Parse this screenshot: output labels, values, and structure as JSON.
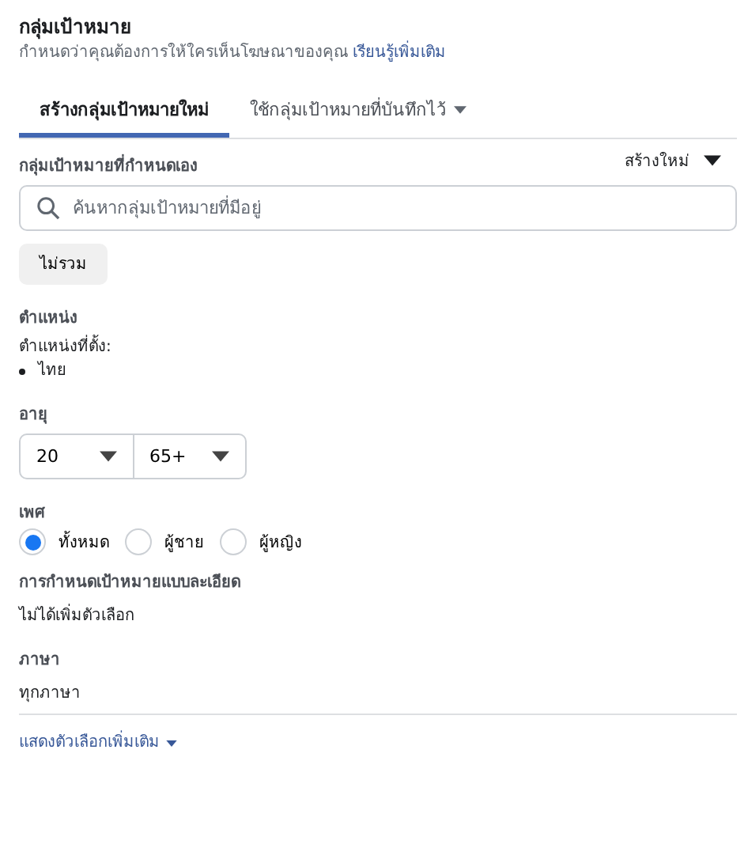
{
  "header": {
    "title": "กลุ่มเป้าหมาย",
    "description": "กำหนดว่าคุณต้องการให้ใครเห็นโฆษณาของคุณ",
    "learn_more_link": "เรียนรู้เพิ่มเติม"
  },
  "tabs": [
    {
      "label": "สร้างกลุ่มเป้าหมายใหม่",
      "selected": true,
      "dropdown": false
    },
    {
      "label": "ใช้กลุ่มเป้าหมายที่บันทึกไว้",
      "selected": false,
      "dropdown": true
    }
  ],
  "custom_audience": {
    "label": "กลุ่มเป้าหมายที่กำหนดเอง",
    "create_new": "สร้างใหม่",
    "search_placeholder": "ค้นหากลุ่มเป้าหมายที่มีอยู่",
    "exclude_button": "ไม่รวม"
  },
  "location": {
    "label": "ตำแหน่ง",
    "sublabel": "ตำแหน่งที่ตั้ง:",
    "items": [
      "ไทย"
    ]
  },
  "age": {
    "label": "อายุ",
    "min": "20",
    "max": "65+"
  },
  "gender": {
    "label": "เพศ",
    "options": [
      {
        "label": "ทั้งหมด",
        "selected": true
      },
      {
        "label": "ผู้ชาย",
        "selected": false
      },
      {
        "label": "ผู้หญิง",
        "selected": false
      }
    ]
  },
  "detailed_targeting": {
    "label": "การกำหนดเป้าหมายแบบละเอียด",
    "value": "ไม่ได้เพิ่มตัวเลือก"
  },
  "languages": {
    "label": "ภาษา",
    "value": "ทุกภาษา"
  },
  "more_options_link": "แสดงตัวเลือกเพิ่มเติม"
}
